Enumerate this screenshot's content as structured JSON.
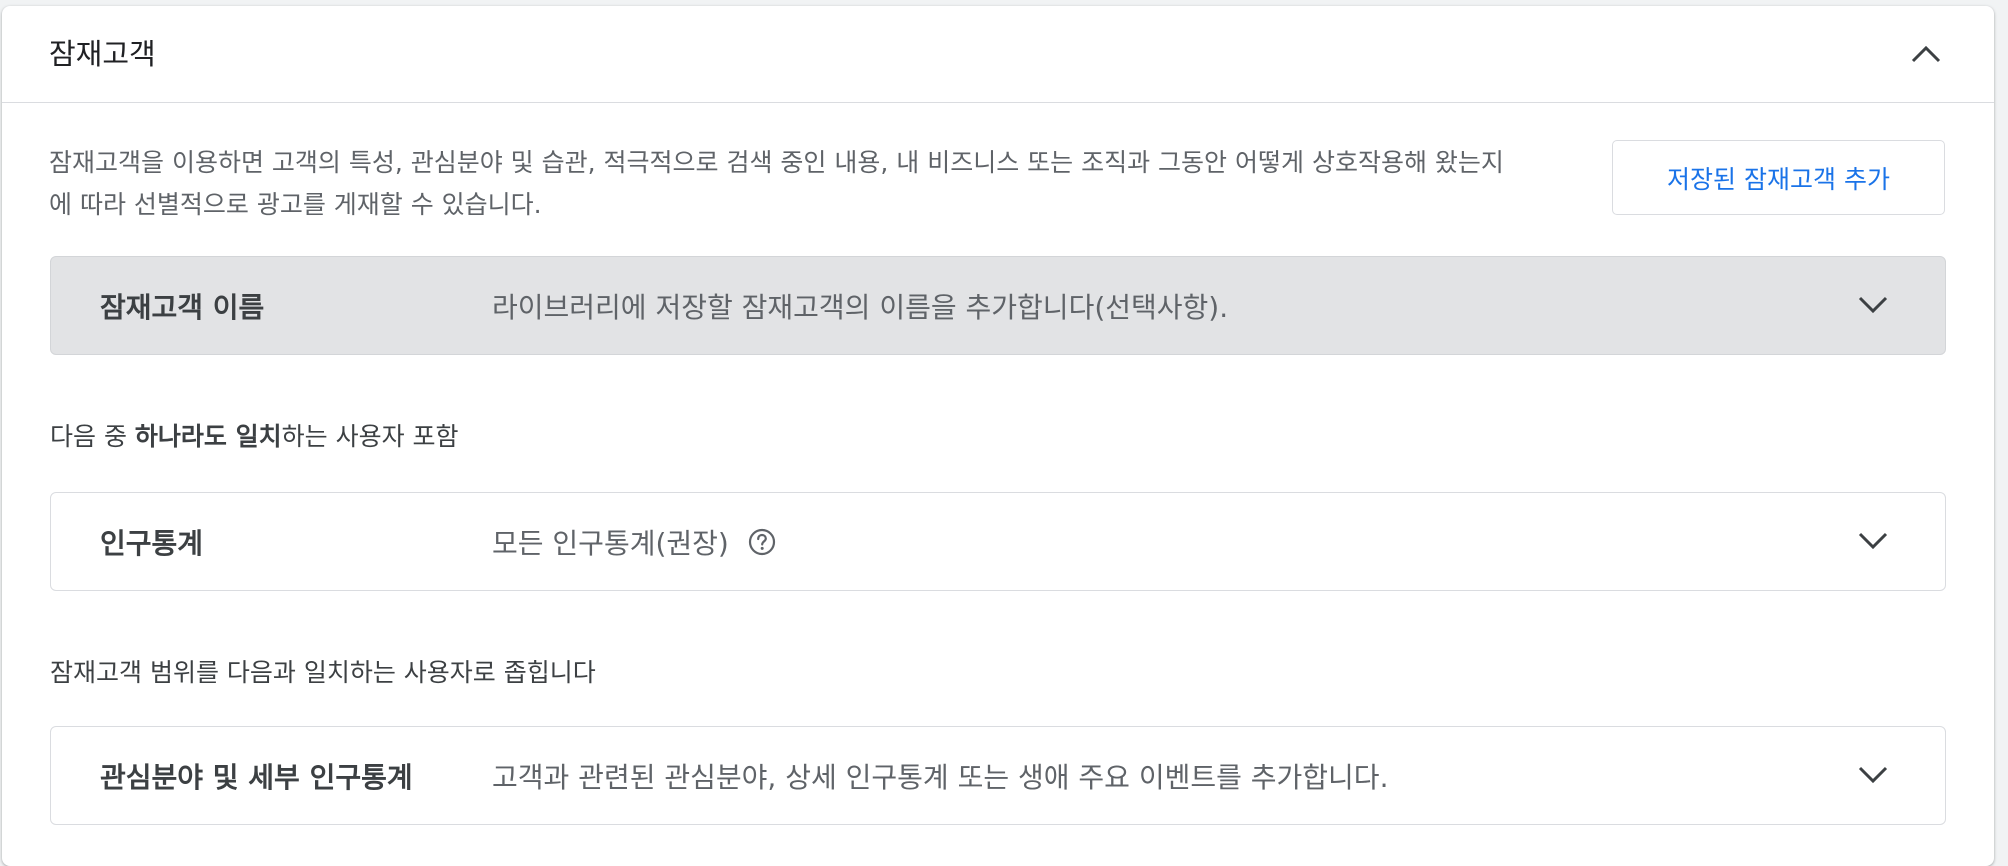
{
  "card": {
    "title": "잠재고객",
    "collapse_icon": "chevron-up-icon"
  },
  "description": {
    "line1": "잠재고객을 이용하면 고객의 특성, 관심분야 및 습관, 적극적으로 검색 중인 내용, 내 비즈니스 또는 조직과 그동안 어떻게 상호작용해 왔는지",
    "line2": "에 따라 선별적으로 광고를 게재할 수 있습니다."
  },
  "add_saved_button": "저장된 잠재고객 추가",
  "audience_name_row": {
    "label": "잠재고객 이름",
    "value": "라이브러리에 저장할 잠재고객의 이름을 추가합니다(선택사항)."
  },
  "include_section": {
    "prefix": "다음 중 ",
    "bold": "하나라도 일치",
    "suffix": "하는 사용자 포함"
  },
  "demographics_row": {
    "label": "인구통계",
    "value": "모든 인구통계(권장)",
    "help_icon": "help-circle-icon"
  },
  "narrow_section": {
    "text": "잠재고객 범위를 다음과 일치하는 사용자로 좁힙니다"
  },
  "interests_row": {
    "label": "관심분야 및 세부 인구통계",
    "value": "고객과 관련된 관심분야, 상세 인구통계 또는 생애 주요 이벤트를 추가합니다."
  },
  "colors": {
    "accent": "#1a73e8",
    "grey_row": "#e2e3e5",
    "border": "#dadce0"
  }
}
